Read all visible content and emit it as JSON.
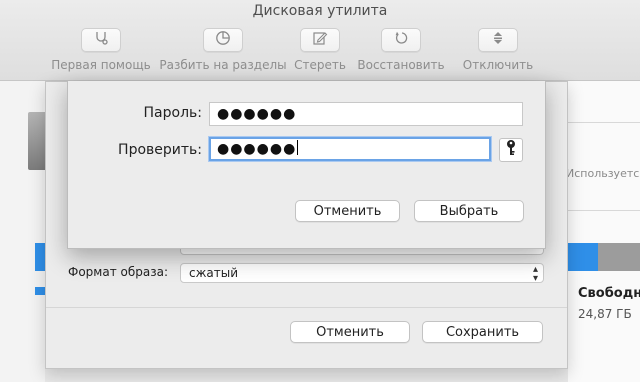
{
  "window": {
    "title": "Дисковая утилита"
  },
  "toolbar": {
    "items": [
      {
        "label": "Первая помощь",
        "icon": "stethoscope-icon"
      },
      {
        "label": "Разбить на разделы",
        "icon": "pie-chart-icon"
      },
      {
        "label": "Стереть",
        "icon": "erase-icon"
      },
      {
        "label": "Восстановить",
        "icon": "restore-icon"
      },
      {
        "label": "Отключить",
        "icon": "unmount-icon"
      }
    ]
  },
  "background": {
    "used_label": "Используется",
    "free_label": "Свободно",
    "free_size": "24,87 ГБ"
  },
  "save_sheet": {
    "hidden_select_value": "",
    "format_label": "Формат образа:",
    "format_value": "сжатый",
    "cancel_label": "Отменить",
    "save_label": "Сохранить"
  },
  "password_dialog": {
    "password_label": "Пароль:",
    "password_value": "●●●●●●",
    "verify_label": "Проверить:",
    "verify_value": "●●●●●●",
    "cancel_label": "Отменить",
    "choose_label": "Выбрать"
  },
  "colors": {
    "accent": "#2f8fe8",
    "focus_ring": "#6aa3e6",
    "used_bar": "#2f8fe8",
    "free_bar": "#9c9c9c"
  }
}
